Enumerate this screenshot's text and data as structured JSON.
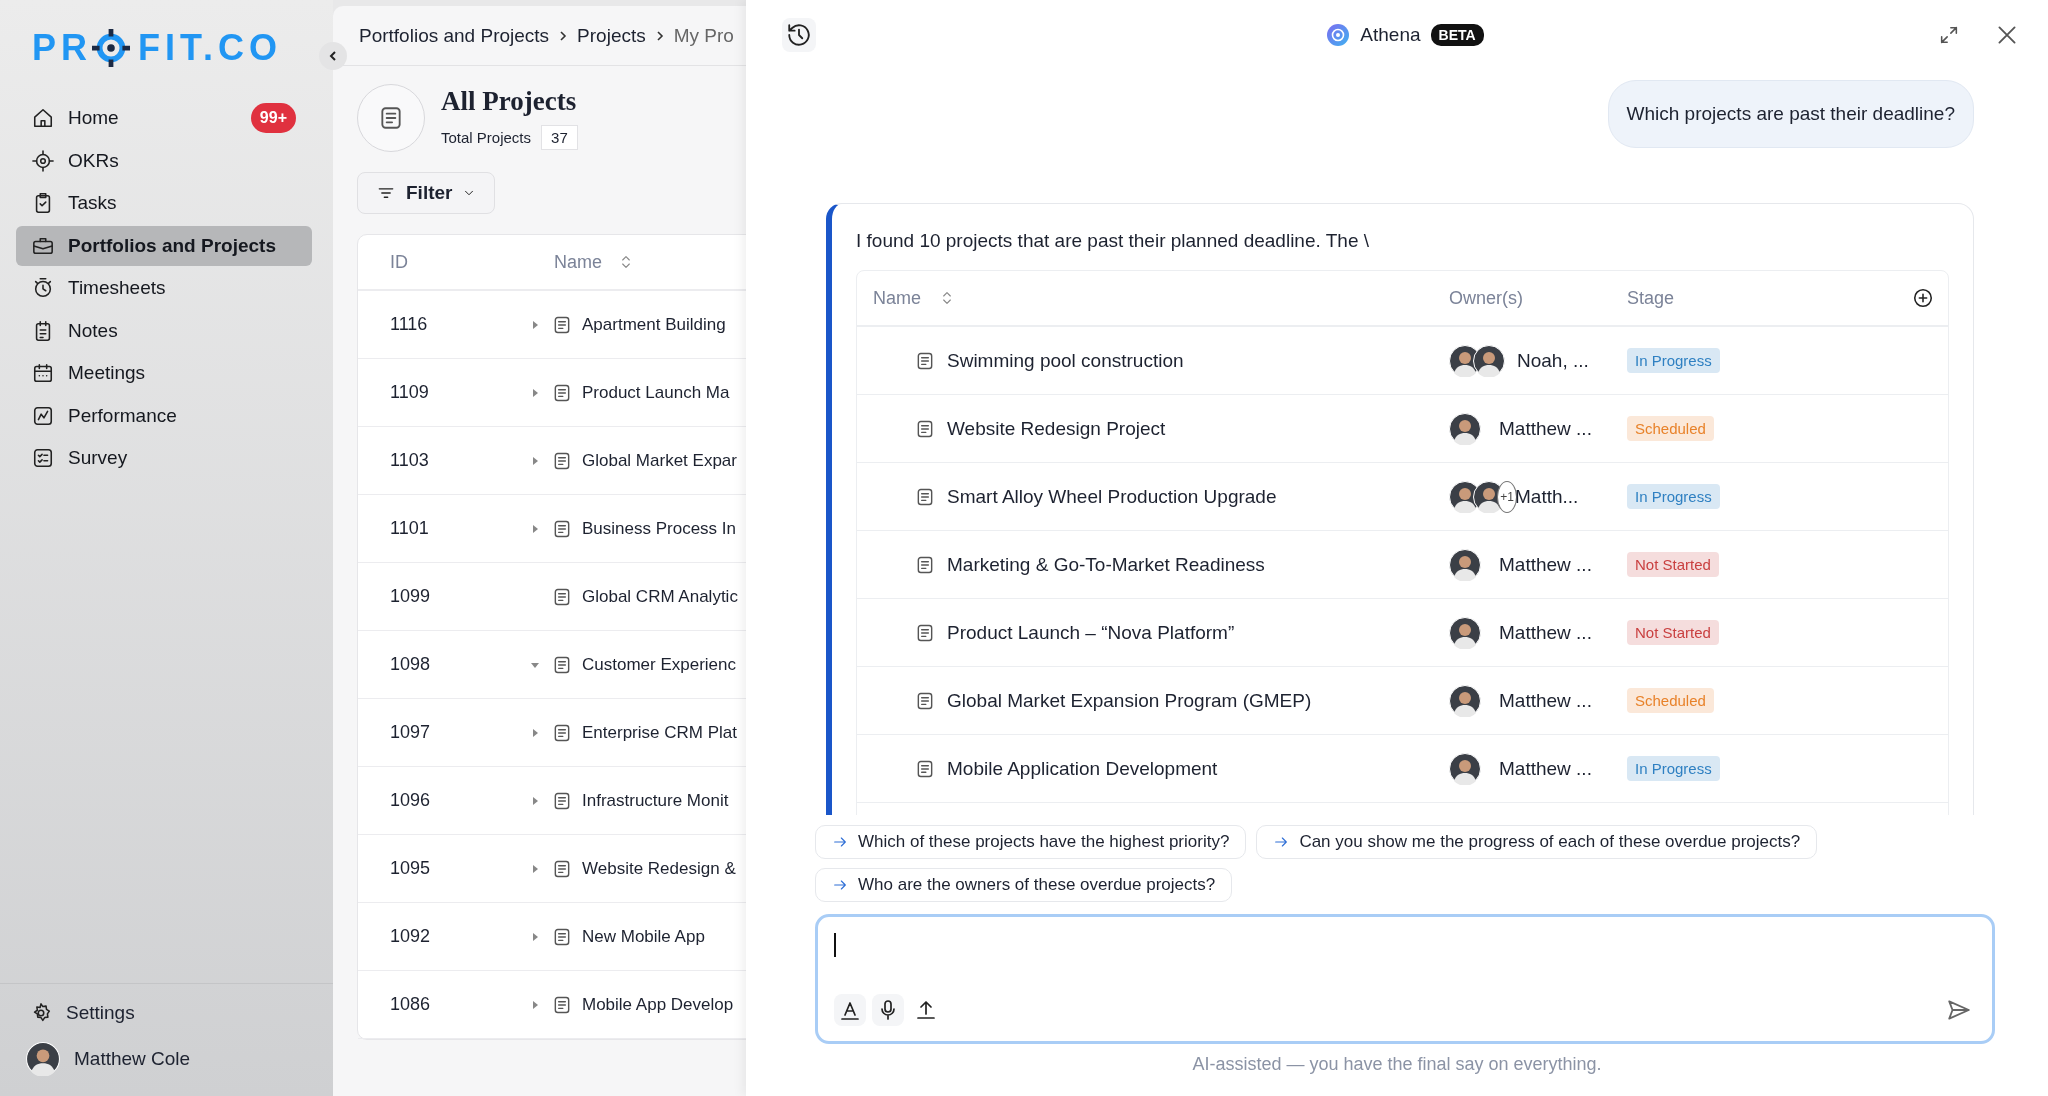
{
  "logo": {
    "before": "PR",
    "after": "FIT.CO"
  },
  "sidebar": {
    "items": [
      {
        "label": "Home",
        "selected": false,
        "badge": "99+"
      },
      {
        "label": "OKRs",
        "selected": false
      },
      {
        "label": "Tasks",
        "selected": false
      },
      {
        "label": "Portfolios and Projects",
        "selected": true
      },
      {
        "label": "Timesheets",
        "selected": false
      },
      {
        "label": "Notes",
        "selected": false
      },
      {
        "label": "Meetings",
        "selected": false
      },
      {
        "label": "Performance",
        "selected": false
      },
      {
        "label": "Survey",
        "selected": false
      }
    ],
    "settings": "Settings",
    "user": "Matthew Cole"
  },
  "breadcrumb": [
    "Portfolios and Projects",
    "Projects",
    "My Pro"
  ],
  "page": {
    "title": "All Projects",
    "total_label": "Total Projects",
    "total": "37",
    "filter": "Filter"
  },
  "table": {
    "columns": [
      "ID",
      "Name"
    ],
    "rows": [
      {
        "id": "1116",
        "name": "Apartment Building",
        "kind": "branch",
        "expanded": false
      },
      {
        "id": "1109",
        "name": "Product Launch Ma",
        "kind": "branch",
        "expanded": false
      },
      {
        "id": "1103",
        "name": "Global Market Expar",
        "kind": "branch",
        "expanded": false
      },
      {
        "id": "1101",
        "name": "Business Process In",
        "kind": "branch",
        "expanded": false
      },
      {
        "id": "1099",
        "name": "Global CRM Analytic",
        "kind": "leaf"
      },
      {
        "id": "1098",
        "name": "Customer Experienc",
        "kind": "branch",
        "expanded": true
      },
      {
        "id": "1097",
        "name": "Enterprise CRM Plat",
        "kind": "branch",
        "expanded": false
      },
      {
        "id": "1096",
        "name": "Infrastructure Monit",
        "kind": "branch",
        "expanded": false
      },
      {
        "id": "1095",
        "name": "Website Redesign &",
        "kind": "branch",
        "expanded": false
      },
      {
        "id": "1092",
        "name": "New Mobile App",
        "kind": "branch",
        "expanded": false
      },
      {
        "id": "1086",
        "name": "Mobile App Develop",
        "kind": "branch",
        "expanded": false
      }
    ]
  },
  "chat": {
    "title": "Athena",
    "badge": "BETA",
    "user_message": "Which projects are past their deadline?",
    "answer": {
      "text": "I found 10 projects that are past their planned deadline. The \\",
      "columns": [
        "Name",
        "Owner(s)",
        "Stage"
      ],
      "rows": [
        {
          "name": "Swimming pool construction",
          "owners": [
            {
              "kind": "person"
            },
            {
              "kind": "person"
            }
          ],
          "owner_text": "Noah, ...",
          "stage": {
            "text": "In Progress",
            "color": "#2f80c2"
          }
        },
        {
          "name": "Website Redesign Project",
          "owners": [
            {
              "kind": "person"
            }
          ],
          "owner_text": "Matthew ...",
          "stage": {
            "text": "Scheduled",
            "color": "#e8822a"
          }
        },
        {
          "name": "Smart Alloy Wheel Production Upgrade",
          "owners": [
            {
              "kind": "person"
            },
            {
              "kind": "person"
            },
            {
              "kind": "more",
              "text": "+1"
            }
          ],
          "owner_text": "Matth...",
          "stage": {
            "text": "In Progress",
            "color": "#2f80c2"
          }
        },
        {
          "name": "Marketing & Go-To-Market Readiness",
          "owners": [
            {
              "kind": "person"
            }
          ],
          "owner_text": "Matthew ...",
          "stage": {
            "text": "Not Started",
            "color": "#c94040"
          }
        },
        {
          "name": "Product Launch – “Nova Platform”",
          "owners": [
            {
              "kind": "person"
            }
          ],
          "owner_text": "Matthew ...",
          "stage": {
            "text": "Not Started",
            "color": "#c94040"
          }
        },
        {
          "name": "Global Market Expansion Program (GMEP)",
          "owners": [
            {
              "kind": "person"
            }
          ],
          "owner_text": "Matthew ...",
          "stage": {
            "text": "Scheduled",
            "color": "#e8822a"
          }
        },
        {
          "name": "Mobile Application Development",
          "owners": [
            {
              "kind": "person"
            }
          ],
          "owner_text": "Matthew ...",
          "stage": {
            "text": "In Progress",
            "color": "#2f80c2"
          }
        }
      ]
    },
    "suggestions": [
      "Which of these projects have the highest priority?",
      "Can you show me the progress of each of these overdue projects?",
      "Who are the owners of these overdue projects?"
    ],
    "footer": "AI-assisted — you have the final say on everything."
  }
}
